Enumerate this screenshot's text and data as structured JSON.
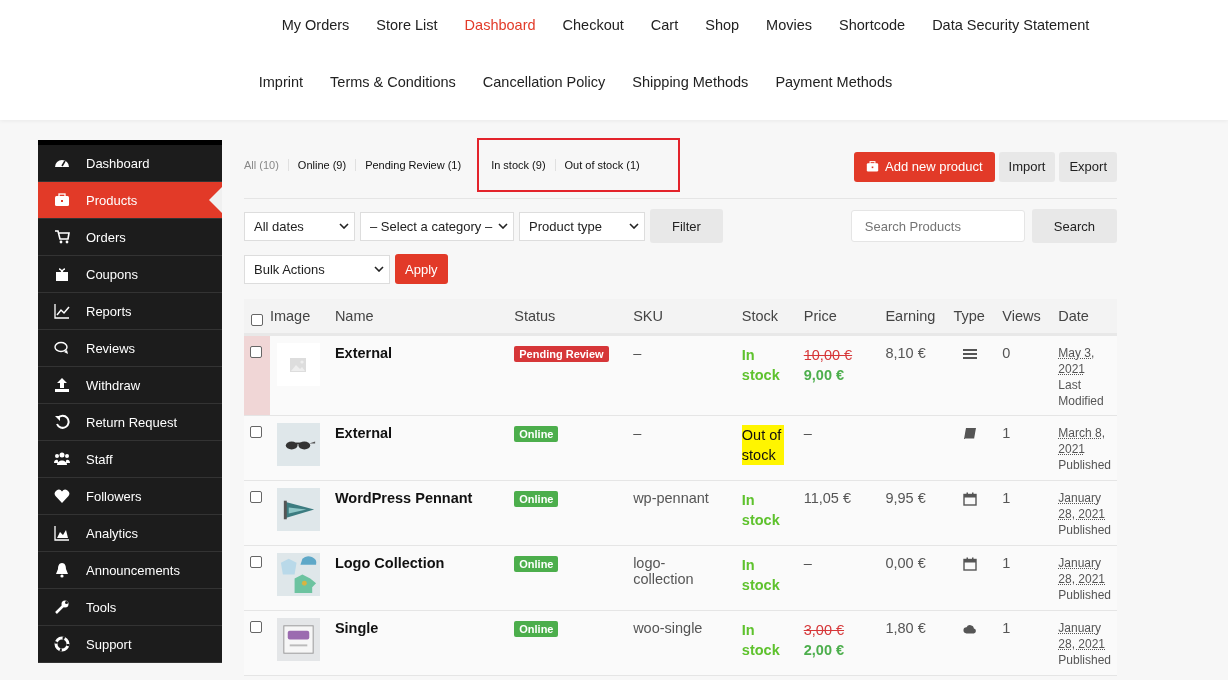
{
  "top_menu": [
    {
      "label": "My Orders",
      "selected": false
    },
    {
      "label": "Store List",
      "selected": false
    },
    {
      "label": "Dashboard",
      "selected": true
    },
    {
      "label": "Checkout",
      "selected": false
    },
    {
      "label": "Cart",
      "selected": false
    },
    {
      "label": "Shop",
      "selected": false
    },
    {
      "label": "Movies",
      "selected": false
    },
    {
      "label": "Shortcode",
      "selected": false
    },
    {
      "label": "Data Security Statement",
      "selected": false
    },
    {
      "label": "Imprint",
      "selected": false
    },
    {
      "label": "Terms & Conditions",
      "selected": false
    },
    {
      "label": "Cancellation Policy",
      "selected": false
    },
    {
      "label": "Shipping Methods",
      "selected": false
    },
    {
      "label": "Payment Methods",
      "selected": false
    }
  ],
  "sidebar": {
    "items": [
      {
        "label": "Dashboard",
        "selected": false
      },
      {
        "label": "Products",
        "selected": true
      },
      {
        "label": "Orders",
        "selected": false
      },
      {
        "label": "Coupons",
        "selected": false
      },
      {
        "label": "Reports",
        "selected": false
      },
      {
        "label": "Reviews",
        "selected": false
      },
      {
        "label": "Withdraw",
        "selected": false
      },
      {
        "label": "Return Request",
        "selected": false
      },
      {
        "label": "Staff",
        "selected": false
      },
      {
        "label": "Followers",
        "selected": false
      },
      {
        "label": "Analytics",
        "selected": false
      },
      {
        "label": "Announcements",
        "selected": false
      },
      {
        "label": "Tools",
        "selected": false
      },
      {
        "label": "Support",
        "selected": false
      }
    ]
  },
  "status_filters": [
    {
      "label": "All (10)",
      "selected": true,
      "highlighted": false
    },
    {
      "label": "Online (9)",
      "selected": false,
      "highlighted": false
    },
    {
      "label": "Pending Review (1)",
      "selected": false,
      "highlighted": false
    },
    {
      "label": "In stock (9)",
      "selected": false,
      "highlighted": true
    },
    {
      "label": "Out of stock (1)",
      "selected": false,
      "highlighted": true
    }
  ],
  "actions": [
    "Add new product",
    "Import",
    "Export"
  ],
  "filters": {
    "dates": "All dates",
    "category": "– Select a category –",
    "product_type": "Product type",
    "filter_button": "Filter",
    "search_placeholder": "Search Products",
    "search_button": "Search",
    "bulk": "Bulk Actions",
    "apply": "Apply"
  },
  "table": {
    "select_all_checked": false,
    "columns": [
      "Image",
      "Name",
      "Status",
      "SKU",
      "Stock",
      "Price",
      "Earning",
      "Type",
      "Views",
      "Date"
    ],
    "rows": [
      {
        "checked": false,
        "flagged": true,
        "name": "External",
        "status": "Pending Review",
        "color": "#d63638",
        "sku": "–",
        "stock": "In stock",
        "in_stock": true,
        "price": "10,00 €",
        "sale_price": "9,00 €",
        "earning": "8,10 €",
        "kind": "list",
        "views": "0",
        "date": "May 3, 2021",
        "date_note": "Last Modified"
      },
      {
        "checked": false,
        "flagged": false,
        "name": "External",
        "status": "Online",
        "color": "#4cae4c",
        "sku": "–",
        "stock": "Out of stock",
        "in_stock": false,
        "price": "–",
        "kind": "book",
        "views": "1",
        "date": "March 8, 2021",
        "date_note": "Published"
      },
      {
        "checked": false,
        "flagged": false,
        "name": "WordPress Pennant",
        "status": "Online",
        "color": "#4cae4c",
        "sku": "wp-pennant",
        "stock": "In stock",
        "in_stock": true,
        "price": "11,05 €",
        "earning": "9,95 €",
        "kind": "calendar",
        "views": "1",
        "date": "January 28, 2021",
        "date_note": "Published"
      },
      {
        "checked": false,
        "flagged": false,
        "name": "Logo Collection",
        "status": "Online",
        "color": "#4cae4c",
        "sku": "logo-collection",
        "stock": "In stock",
        "in_stock": true,
        "price": "–",
        "earning": "0,00 €",
        "kind": "calendar",
        "views": "1",
        "date": "January 28, 2021",
        "date_note": "Published"
      },
      {
        "checked": false,
        "flagged": false,
        "name": "Single",
        "status": "Online",
        "color": "#4cae4c",
        "sku": "woo-single",
        "stock": "In stock",
        "in_stock": true,
        "price": "3,00 €",
        "sale_price": "2,00 €",
        "earning": "1,80 €",
        "kind": "cloud",
        "views": "1",
        "date": "January 28, 2021",
        "date_note": "Published"
      }
    ]
  }
}
